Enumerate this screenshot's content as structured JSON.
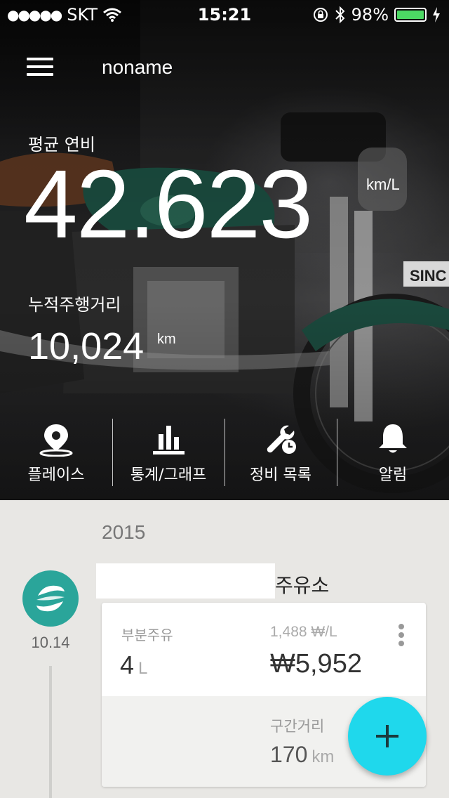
{
  "status_bar": {
    "carrier": "SKT",
    "time": "15:21",
    "battery": "98%"
  },
  "header": {
    "title": "noname",
    "menu_icon": "hamburger-icon"
  },
  "stats": {
    "avg_label": "평균 연비",
    "avg_value": "42.623",
    "avg_unit": "km/L",
    "distance_label": "누적주행거리",
    "distance_value": "10,024",
    "distance_unit": "km"
  },
  "nav": {
    "items": [
      {
        "label": "플레이스",
        "icon": "location-pin-icon"
      },
      {
        "label": "통계/그래프",
        "icon": "bar-chart-icon"
      },
      {
        "label": "정비 목록",
        "icon": "wrench-icon"
      },
      {
        "label": "알림",
        "icon": "bell-icon"
      }
    ]
  },
  "records": {
    "year": "2015",
    "entry": {
      "date": "10.14",
      "station_suffix": "주유소",
      "fill_type": "부분주유",
      "fill_amount": "4",
      "fill_unit": "L",
      "unit_price": "1,488 ₩/L",
      "total_price": "₩5,952",
      "segment_label": "구간거리",
      "segment_value": "170",
      "segment_unit": "km"
    }
  },
  "colors": {
    "fab": "#1fd8ec",
    "station_logo": "#2aa59a",
    "battery": "#4cd964"
  }
}
